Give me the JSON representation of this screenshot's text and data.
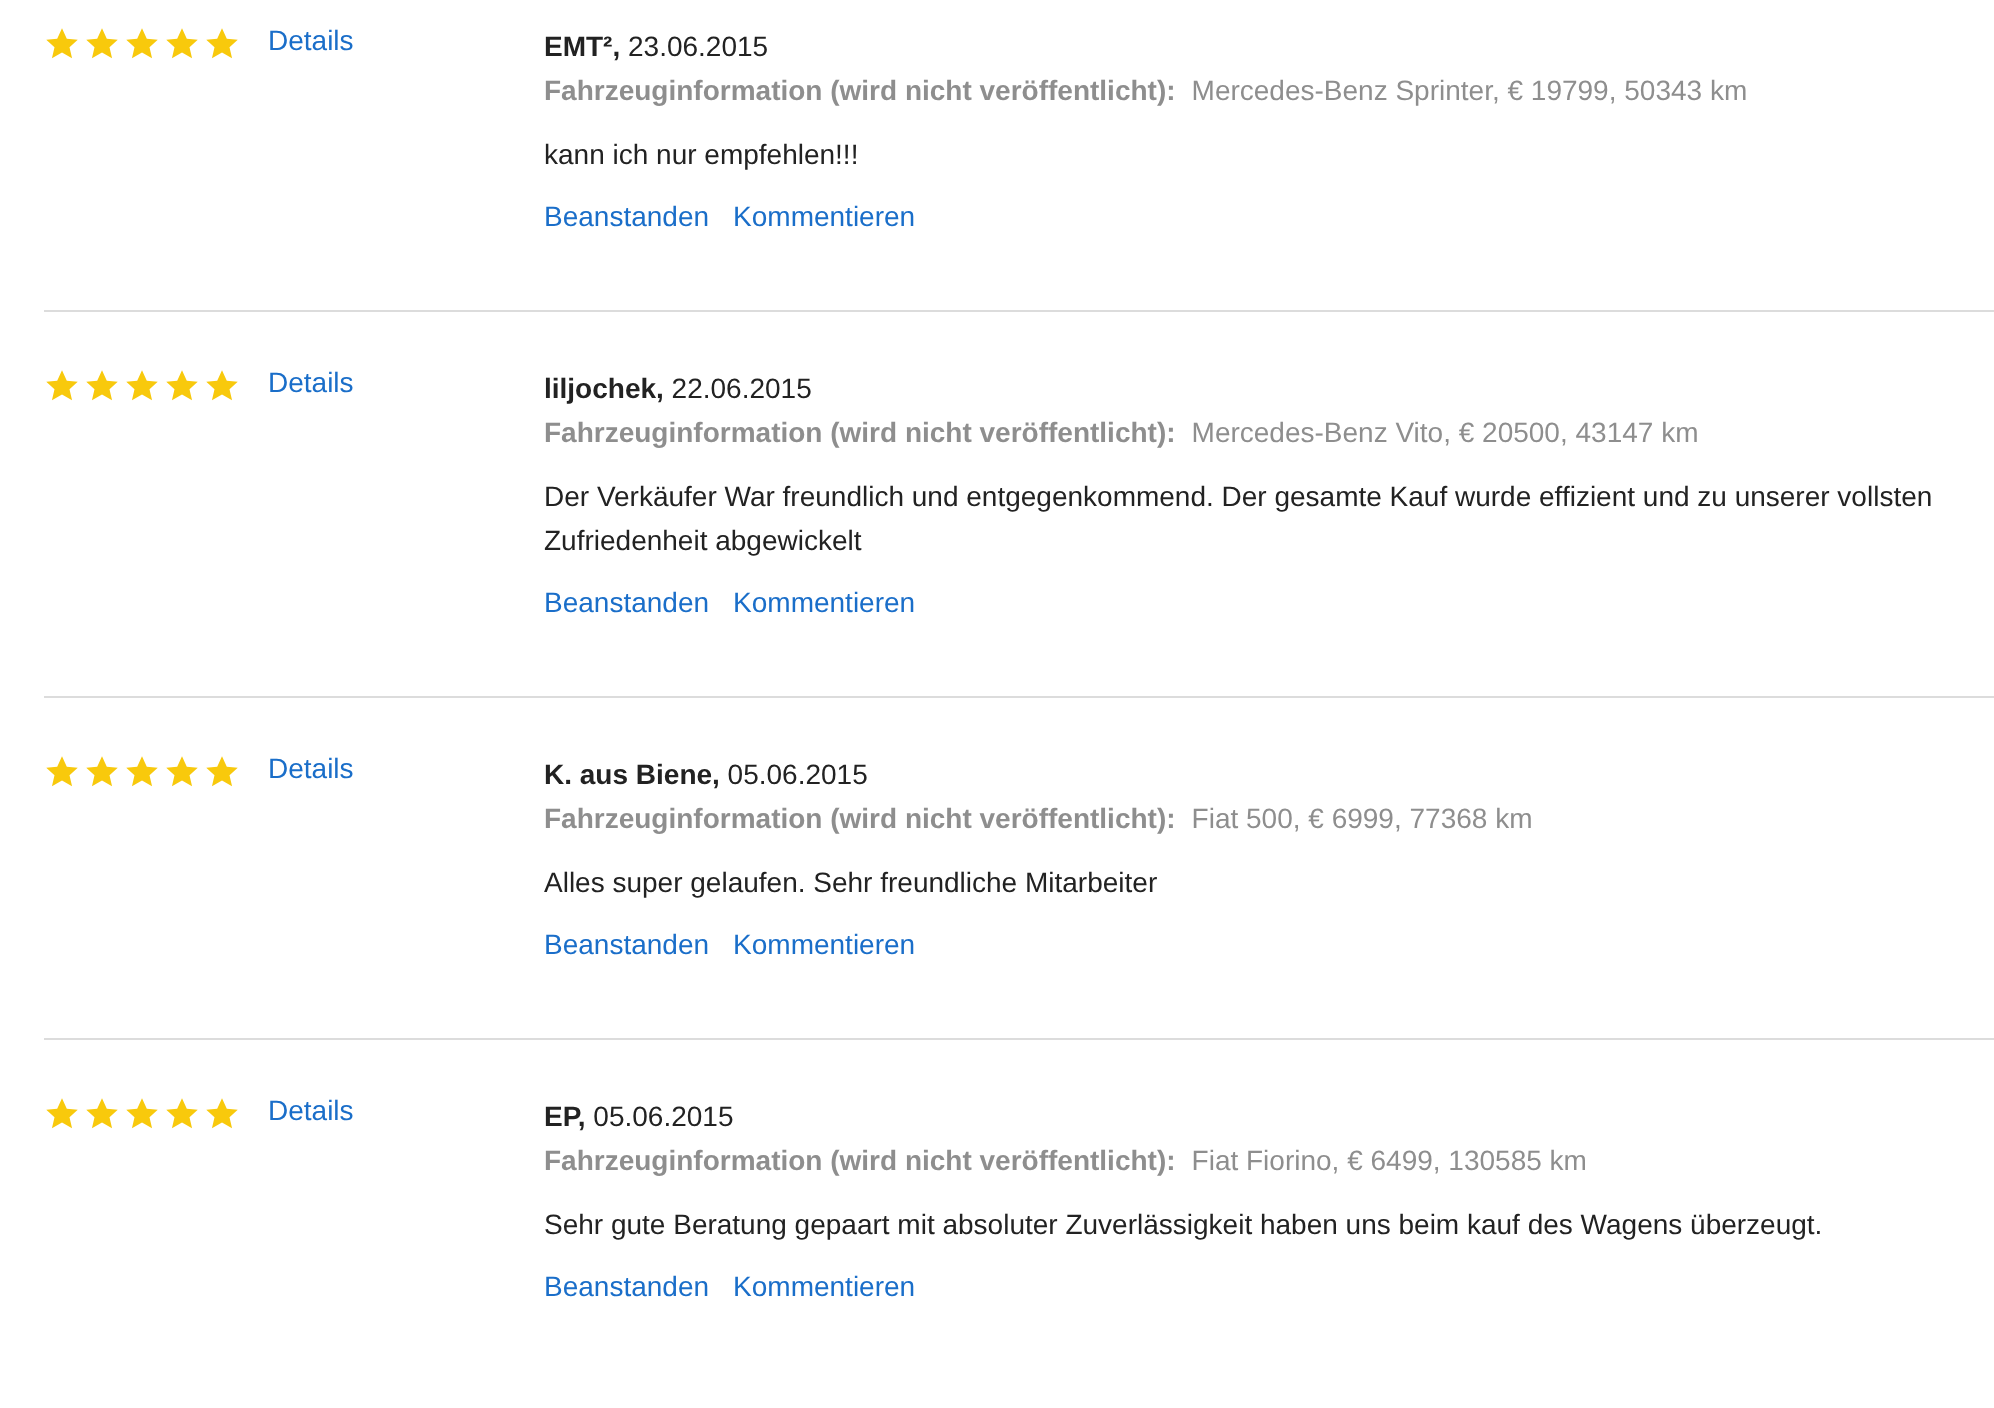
{
  "reviews": [
    {
      "stars": 5,
      "details": "Details",
      "heading": "**EMT²,** 23.06.2015",
      "info_label": "Fahrzeuginformation (wird nicht veröffentlicht):",
      "info_value": "Mercedes-Benz Sprinter, € 19799, 50343 km",
      "text": "kann ich nur empfehlen!!!",
      "actions": [
        "Beanstanden",
        "Kommentieren"
      ]
    },
    {
      "stars": 5,
      "details": "Details",
      "heading": "**liljochek,** 22.06.2015",
      "info_label": "Fahrzeuginformation (wird nicht veröffentlicht):",
      "info_value": "Mercedes-Benz Vito, € 20500, 43147 km",
      "text": "Der Verkäufer War freundlich und entgegenkommend. Der gesamte Kauf wurde effizient und zu unserer vollsten Zufriedenheit abgewickelt",
      "actions": [
        "Beanstanden",
        "Kommentieren"
      ]
    },
    {
      "stars": 5,
      "details": "Details",
      "heading": "**K. aus Biene,** 05.06.2015",
      "info_label": "Fahrzeuginformation (wird nicht veröffentlicht):",
      "info_value": "Fiat 500, € 6999, 77368 km",
      "text": "Alles super gelaufen. Sehr freundliche Mitarbeiter",
      "actions": [
        "Beanstanden",
        "Kommentieren"
      ]
    },
    {
      "stars": 5,
      "details": "Details",
      "heading": "**EP,** 05.06.2015",
      "info_label": "Fahrzeuginformation (wird nicht veröffentlicht):",
      "info_value": "Fiat Fiorino, € 6499, 130585 km",
      "text": "Sehr gute Beratung gepaart mit absoluter Zuverlässigkeit haben uns beim kauf des Wagens überzeugt.",
      "actions": [
        "Beanstanden",
        "Kommentieren"
      ]
    }
  ]
}
